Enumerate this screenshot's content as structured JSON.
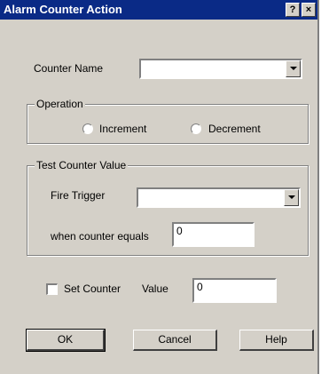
{
  "window": {
    "title": "Alarm Counter Action",
    "help_button": "?",
    "close_button": "×"
  },
  "counter_name": {
    "label": "Counter Name",
    "value": ""
  },
  "operation": {
    "group_title": "Operation",
    "increment_label": "Increment",
    "decrement_label": "Decrement"
  },
  "test_counter": {
    "group_title": "Test Counter Value",
    "fire_trigger_label": "Fire Trigger",
    "fire_trigger_value": "",
    "when_equals_label": "when counter equals",
    "when_equals_value": "0"
  },
  "set_counter": {
    "checkbox_label": "Set Counter",
    "checked": false,
    "value_label": "Value",
    "value": "0"
  },
  "buttons": {
    "ok": "OK",
    "cancel": "Cancel",
    "help": "Help"
  }
}
